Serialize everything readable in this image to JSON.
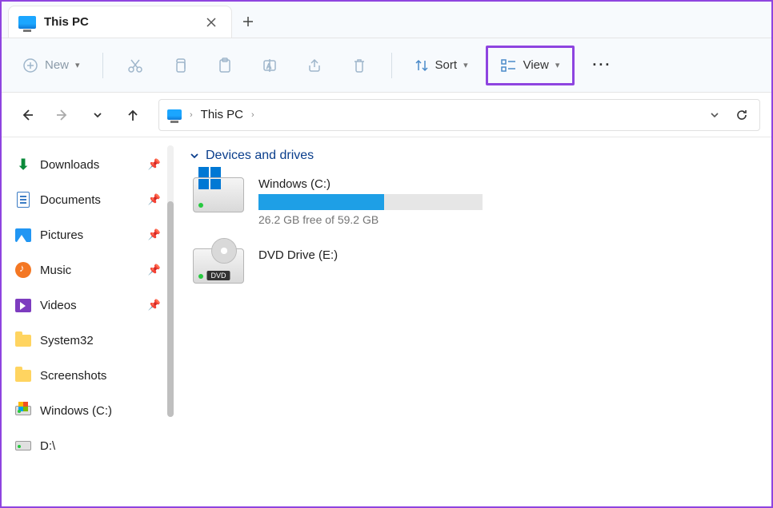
{
  "tab": {
    "title": "This PC"
  },
  "toolbar": {
    "new_label": "New",
    "sort_label": "Sort",
    "view_label": "View"
  },
  "breadcrumb": {
    "current": "This PC"
  },
  "sidebar": {
    "items": [
      {
        "label": "Downloads",
        "pinned": true
      },
      {
        "label": "Documents",
        "pinned": true
      },
      {
        "label": "Pictures",
        "pinned": true
      },
      {
        "label": "Music",
        "pinned": true
      },
      {
        "label": "Videos",
        "pinned": true
      },
      {
        "label": "System32",
        "pinned": false
      },
      {
        "label": "Screenshots",
        "pinned": false
      },
      {
        "label": "Windows (C:)",
        "pinned": false
      },
      {
        "label": "D:\\",
        "pinned": false
      }
    ]
  },
  "main": {
    "group_header": "Devices and drives",
    "drives": [
      {
        "name": "Windows (C:)",
        "free_text": "26.2 GB free of 59.2 GB",
        "used_percent": 56
      },
      {
        "name": "DVD Drive (E:)"
      }
    ],
    "dvd_badge": "DVD"
  }
}
